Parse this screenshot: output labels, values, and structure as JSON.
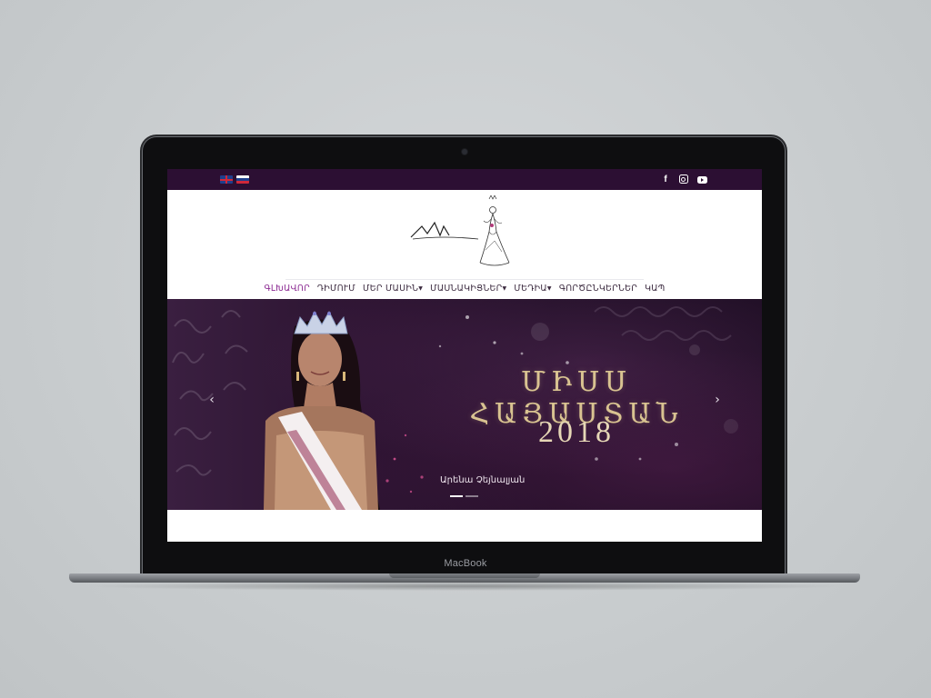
{
  "device": {
    "label": "MacBook"
  },
  "topbar": {
    "languages": [
      {
        "name": "english-flag-icon",
        "colors": [
          "#1f3f8c",
          "#d0283a",
          "#ffffff"
        ]
      },
      {
        "name": "russian-flag-icon",
        "colors": [
          "#ffffff",
          "#1f3f8c",
          "#d0283a"
        ]
      }
    ],
    "social": [
      {
        "icon": "facebook-icon",
        "label": "f"
      },
      {
        "icon": "instagram-icon"
      },
      {
        "icon": "youtube-icon"
      }
    ],
    "background": "#2c0f33"
  },
  "nav": {
    "items": [
      {
        "label": "ԳԼԽԱՎՈՐ",
        "active": true
      },
      {
        "label": "ԴԻՄՈՒՄ"
      },
      {
        "label": "ՄԵՐ ՄԱՍԻՆ",
        "dropdown": true
      },
      {
        "label": "ՄԱՍՆԱԿԻՑՆԵՐ",
        "dropdown": true
      },
      {
        "label": "ՄԵԴԻԱ",
        "dropdown": true
      },
      {
        "label": "ԳՈՐԾԸՆԿԵՐՆԵՐ"
      },
      {
        "label": "ԿԱՊ"
      }
    ],
    "active_color": "#8c2b93",
    "text_color": "#3b2a3f"
  },
  "hero": {
    "title": "ՄԻՍՍ ՀԱՅԱՍՏԱՆ",
    "year": "2018",
    "caption": "Արենա Չեյնալյան",
    "prev_arrow": "‹",
    "next_arrow": "›",
    "slides": {
      "current": 1,
      "total": 2
    },
    "title_color": "#d9c391"
  }
}
